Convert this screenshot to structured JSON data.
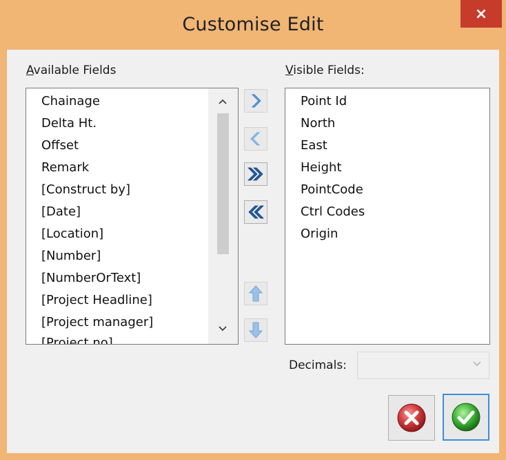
{
  "window": {
    "title": "Customise Edit",
    "close_glyph": "×"
  },
  "available": {
    "label_mnemonic": "A",
    "label_rest": "vailable Fields",
    "items": [
      "Chainage",
      "Delta Ht.",
      "Offset",
      "Remark",
      "[Construct by]",
      "[Date]",
      "[Location]",
      "[Number]",
      "[NumberOrText]",
      "[Project Headline]",
      "[Project manager]",
      "[Project no]"
    ]
  },
  "visible": {
    "label_mnemonic": "V",
    "label_rest": "isible Fields:",
    "items": [
      "Point Id",
      "North",
      "East",
      "Height",
      "PointCode",
      "Ctrl Codes",
      "Origin"
    ]
  },
  "buttons": {
    "move_right": "move-right-icon",
    "move_left": "move-left-icon",
    "move_all_right": "move-all-right-icon",
    "move_all_left": "move-all-left-icon",
    "move_up": "arrow-up-icon",
    "move_down": "arrow-down-icon",
    "cancel": "cancel-icon",
    "ok": "ok-icon"
  },
  "decimals": {
    "label": "Decimals:",
    "value": ""
  },
  "colors": {
    "frame": "#f1b574",
    "close": "#c73b2b",
    "arrow_active": "#1f5fa8",
    "arrow_disabled": "#9cc0e6"
  }
}
